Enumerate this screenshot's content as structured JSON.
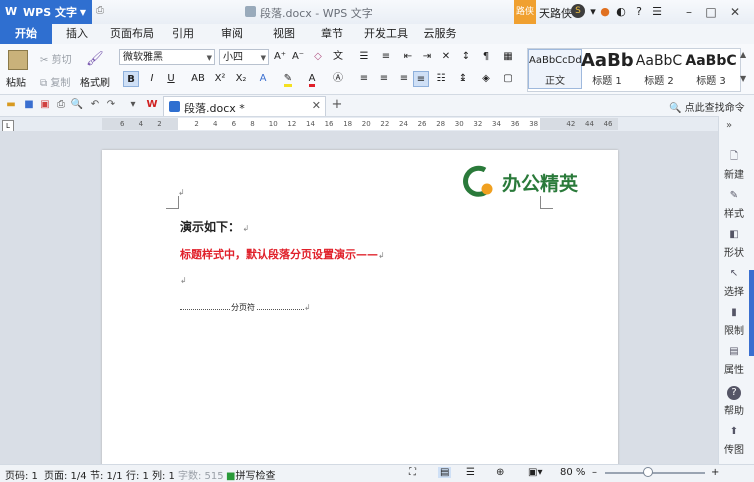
{
  "titlebar": {
    "app_name": "WPS 文字",
    "document_title": "段落.docx - WPS 文字",
    "badge": "路侠",
    "user_name": "天路侠",
    "icons": [
      "gear-icon",
      "help-icon",
      "skin-icon",
      "menu-icon"
    ],
    "window_buttons": [
      "minimize",
      "maximize",
      "close"
    ]
  },
  "menu_tabs": [
    "开始",
    "插入",
    "页面布局",
    "引用",
    "审阅",
    "视图",
    "章节",
    "开发工具",
    "云服务"
  ],
  "ribbon": {
    "paste": "粘贴",
    "cut": "剪切",
    "copy": "复制",
    "format_painter": "格式刷",
    "font_name": "微软雅黑",
    "font_size": "小四",
    "styles": [
      {
        "sample": "AaBbCcDd",
        "label": "正文"
      },
      {
        "sample": "AaBb",
        "label": "标题 1"
      },
      {
        "sample": "AaBbC",
        "label": "标题 2"
      },
      {
        "sample": "AaBbC",
        "label": "标题 3"
      }
    ]
  },
  "quickbar": {
    "doc_tab_name": "段落.docx *",
    "search_command": "点此查找命令"
  },
  "ruler_ticks": [
    "6",
    "4",
    "2",
    "",
    "2",
    "4",
    "6",
    "8",
    "10",
    "12",
    "14",
    "16",
    "18",
    "20",
    "22",
    "24",
    "26",
    "28",
    "30",
    "32",
    "34",
    "36",
    "38",
    "",
    "42",
    "44",
    "46"
  ],
  "document": {
    "logo_text": "办公精英",
    "heading": "演示如下：",
    "red_line": "标题样式中，默认段落分页设置演示——",
    "page_break_label": "分页符"
  },
  "right_panel": [
    "新建",
    "样式",
    "形状",
    "选择",
    "限制",
    "属性",
    "帮助",
    "传图"
  ],
  "status": {
    "page": "页码: 1",
    "pages": "页面: 1/4",
    "section": "节: 1/1",
    "row": "行: 1",
    "col": "列: 1",
    "wordcount": "字数: 515",
    "spellcheck": "拼写检查",
    "zoom": "80 %"
  },
  "colors": {
    "accent": "#2f6fd0",
    "red_text": "#e0202a",
    "logo_green": "#2a7a3a",
    "logo_orange": "#f0a020"
  }
}
